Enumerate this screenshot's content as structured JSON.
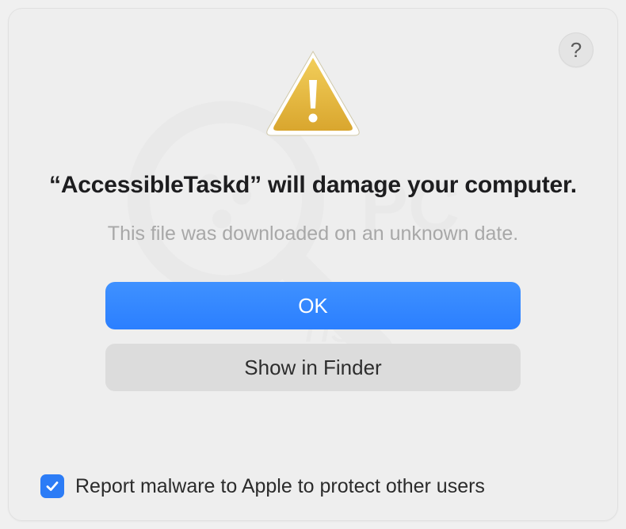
{
  "dialog": {
    "title": "“AccessibleTaskd” will damage your computer.",
    "subtitle": "This file was downloaded on an unknown date.",
    "primary_button_label": "OK",
    "secondary_button_label": "Show in Finder",
    "checkbox_label": "Report malware to Apple to protect other users",
    "checkbox_checked": true,
    "help_label": "?"
  }
}
